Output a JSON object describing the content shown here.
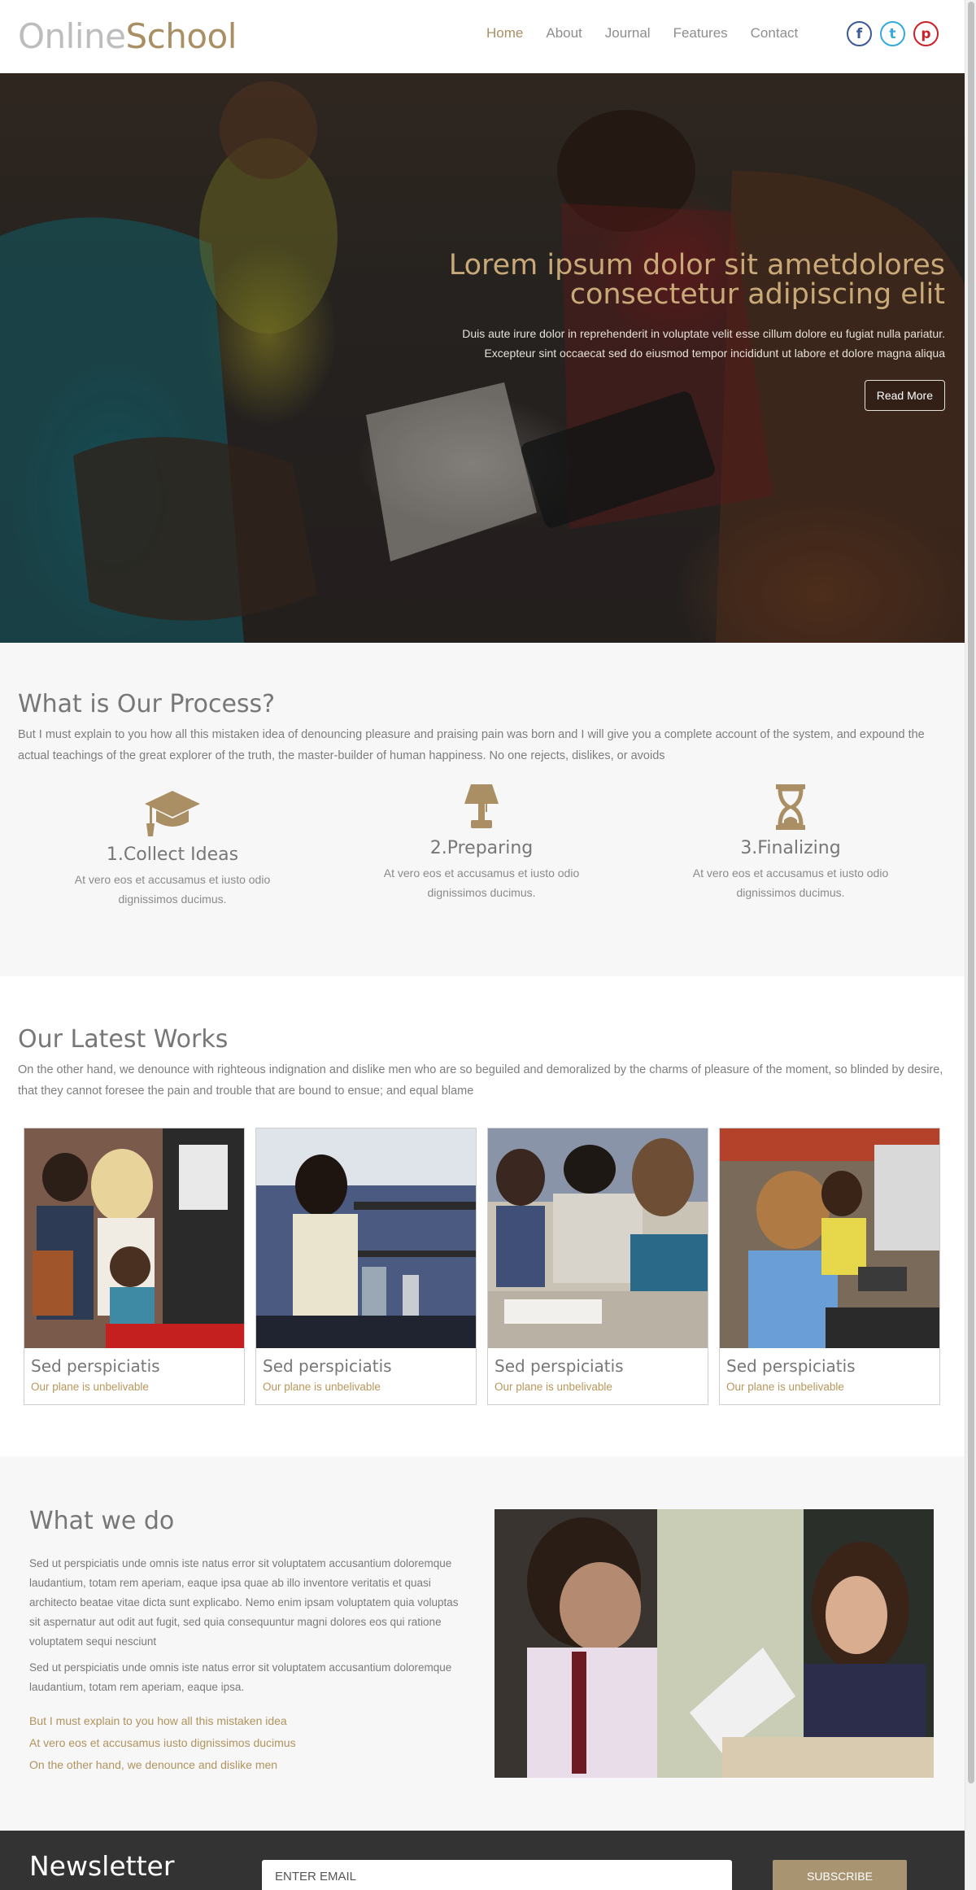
{
  "header": {
    "logo_part1": "Online",
    "logo_part2": "School",
    "nav": [
      "Home",
      "About",
      "Journal",
      "Features",
      "Contact"
    ],
    "nav_active": "Home",
    "social": [
      {
        "icon": "facebook-icon",
        "glyph": "f",
        "color": "#3b5998"
      },
      {
        "icon": "twitter-icon",
        "glyph": "t",
        "color": "#33aadd"
      },
      {
        "icon": "pinterest-icon",
        "glyph": "p",
        "color": "#cb2027"
      }
    ]
  },
  "hero": {
    "title_line1": "Lorem ipsum dolor sit ametdolores",
    "title_line2": "consectetur adipiscing elit",
    "text_line1": "Duis aute irure dolor in reprehenderit in voluptate velit esse cillum dolore eu fugiat nulla pariatur.",
    "text_line2": "Excepteur sint occaecat sed do eiusmod tempor incididunt ut labore et dolore magna aliqua",
    "button": "Read More"
  },
  "process": {
    "title": "What is Our Process?",
    "text": "But I must explain to you how all this mistaken idea of denouncing pleasure and praising pain was born and I will give you a complete account of the system, and expound the actual teachings of the great explorer of the truth, the master-builder of human happiness. No one rejects, dislikes, or avoids",
    "steps": [
      {
        "title": "1.Collect Ideas",
        "desc": "At vero eos et accusamus et iusto odio dignissimos ducimus.",
        "icon": "graduation-cap-icon"
      },
      {
        "title": "2.Preparing",
        "desc": "At vero eos et accusamus et iusto odio dignissimos ducimus.",
        "icon": "lamp-icon"
      },
      {
        "title": "3.Finalizing",
        "desc": "At vero eos et accusamus et iusto odio dignissimos ducimus.",
        "icon": "hourglass-icon"
      }
    ]
  },
  "works": {
    "title": "Our Latest Works",
    "text": "On the other hand, we denounce with righteous indignation and dislike men who are so beguiled and demoralized by the charms of pleasure of the moment, so blinded by desire, that they cannot foresee the pain and trouble that are bound to ensue; and equal blame",
    "items": [
      {
        "title": "Sed perspiciatis",
        "subtitle": "Our plane is unbelivable"
      },
      {
        "title": "Sed perspiciatis",
        "subtitle": "Our plane is unbelivable"
      },
      {
        "title": "Sed perspiciatis",
        "subtitle": "Our plane is unbelivable"
      },
      {
        "title": "Sed perspiciatis",
        "subtitle": "Our plane is unbelivable"
      }
    ]
  },
  "whatwedo": {
    "title": "What we do",
    "p1": "Sed ut perspiciatis unde omnis iste natus error sit voluptatem accusantium doloremque laudantium, totam rem aperiam, eaque ipsa quae ab illo inventore veritatis et quasi architecto beatae vitae dicta sunt explicabo. Nemo enim ipsam voluptatem quia voluptas sit aspernatur aut odit aut fugit, sed quia consequuntur magni dolores eos qui ratione voluptatem sequi nesciunt",
    "p2": "Sed ut perspiciatis unde omnis iste natus error sit voluptatem accusantium doloremque laudantium, totam rem aperiam, eaque ipsa.",
    "links": [
      "But I must explain to you how all this mistaken idea",
      "At vero eos et accusamus iusto dignissimos ducimus",
      "On the other hand, we denounce and dislike men"
    ]
  },
  "newsletter": {
    "title": "Newsletter",
    "placeholder": "ENTER EMAIL",
    "button": "SUBSCRIBE"
  },
  "colors": {
    "accent": "#a98f63",
    "dark_footer": "#333333",
    "section_bg": "#f7f7f7"
  }
}
